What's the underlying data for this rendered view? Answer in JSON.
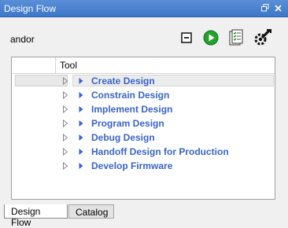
{
  "window": {
    "title": "Design Flow"
  },
  "colors": {
    "title_bar": "#3d77c8",
    "item_text": "#3a64c8",
    "arrow": "#3a64c8"
  },
  "toolbar": {
    "device": "andor",
    "icons": [
      "collapse-all-icon",
      "run-icon",
      "report-icon",
      "settings-wrench-icon"
    ]
  },
  "tree": {
    "header": "Tool",
    "items": [
      {
        "label": "Create Design",
        "selected": true
      },
      {
        "label": "Constrain Design"
      },
      {
        "label": "Implement Design"
      },
      {
        "label": "Program Design"
      },
      {
        "label": "Debug Design"
      },
      {
        "label": "Handoff Design for Production"
      },
      {
        "label": "Develop Firmware"
      }
    ]
  },
  "tabs": [
    {
      "label": "Design Flow",
      "active": true
    },
    {
      "label": "Catalog",
      "active": false
    }
  ]
}
